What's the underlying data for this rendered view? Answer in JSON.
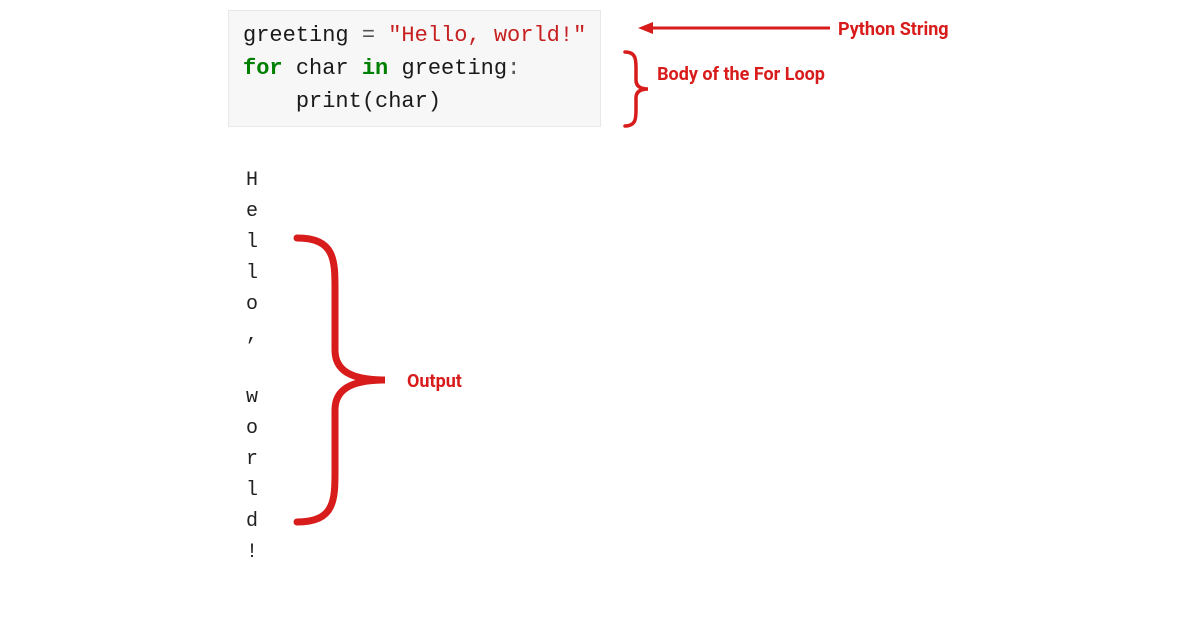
{
  "code": {
    "line1": {
      "var": "greeting",
      "op": " = ",
      "str": "\"Hello, world!\""
    },
    "line2": {
      "kw1": "for",
      "sp1": " ",
      "var1": "char",
      "sp2": " ",
      "kw2": "in",
      "sp3": " ",
      "var2": "greeting",
      "colon": ":"
    },
    "line3": {
      "indent": "    ",
      "func": "print",
      "open": "(",
      "arg": "char",
      "close": ")"
    }
  },
  "output_text": "H\ne\nl\nl\no\n,\n \nw\no\nr\nl\nd\n!",
  "annotations": {
    "python_string": "Python String",
    "body": "Body of the For Loop",
    "output": "Output"
  }
}
